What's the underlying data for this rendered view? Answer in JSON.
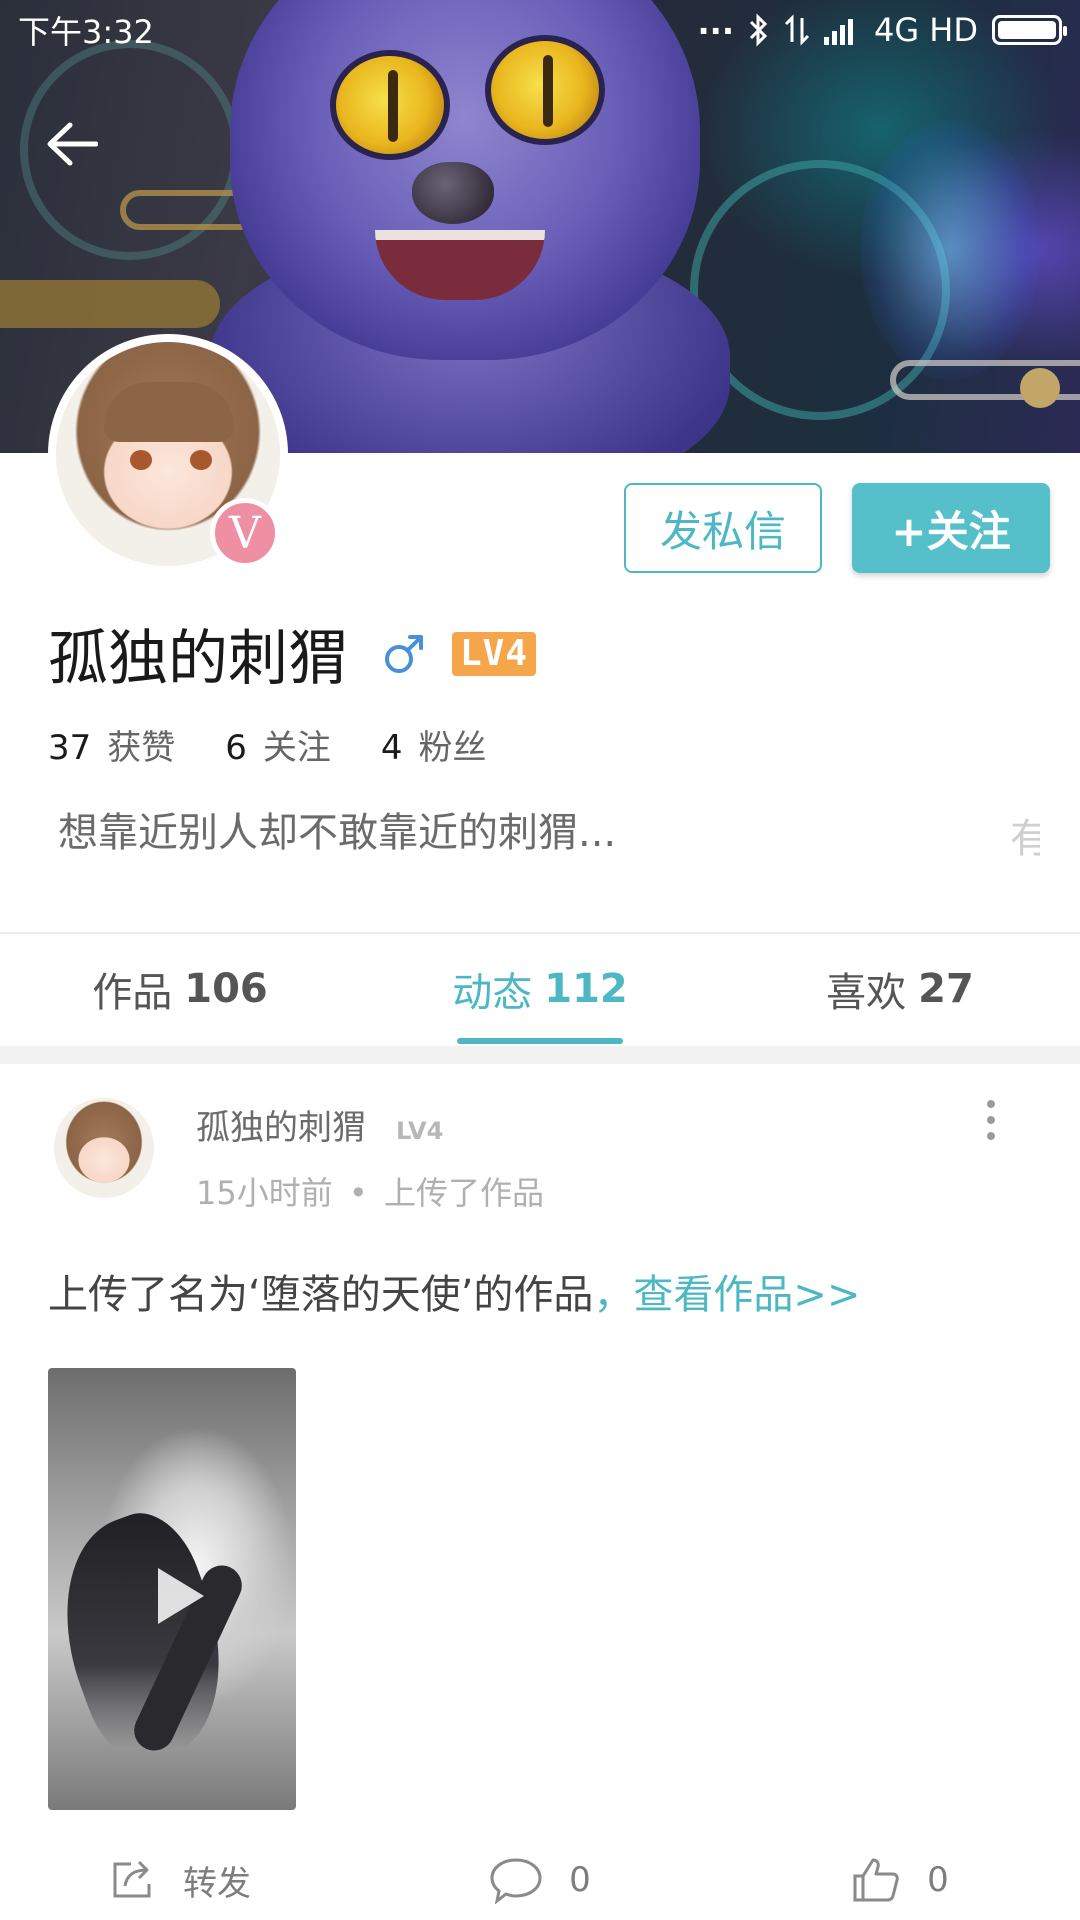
{
  "status_bar": {
    "time": "下午3:32",
    "dots": "...",
    "network": "4G HD"
  },
  "profile": {
    "username": "孤独的刺猬",
    "gender": "male",
    "level": "LV4",
    "verified_badge": "V",
    "stats": [
      {
        "value": "37",
        "label": "获赞"
      },
      {
        "value": "6",
        "label": "关注"
      },
      {
        "value": "4",
        "label": "粉丝"
      }
    ],
    "bio": "想靠近别人却不敢靠近的刺猬...",
    "bio_overflow": "有"
  },
  "actions": {
    "message_label": "发私信",
    "follow_label": "+关注"
  },
  "tabs": [
    {
      "label": "作品",
      "count": "106",
      "active": false
    },
    {
      "label": "动态",
      "count": "112",
      "active": true
    },
    {
      "label": "喜欢",
      "count": "27",
      "active": false
    }
  ],
  "post": {
    "author": "孤独的刺猬",
    "level": "LV4",
    "time": "15小时前",
    "separator": "•",
    "action": "上传了作品",
    "text": "上传了名为‘堕落的天使’的作品",
    "link_text": "，查看作品>>",
    "share_label": "转发",
    "comment_count": "0",
    "like_count": "0"
  },
  "colors": {
    "accent": "#4db8c4",
    "follow_button": "#55bfca",
    "level_badge": "#f5a54a",
    "verified_badge": "#ef8fa4"
  },
  "icons": [
    "back-arrow-icon",
    "bluetooth-icon",
    "data-arrows-icon",
    "signal-icon",
    "battery-icon",
    "male-icon",
    "more-vertical-icon",
    "play-icon",
    "share-icon",
    "comment-icon",
    "like-icon"
  ]
}
